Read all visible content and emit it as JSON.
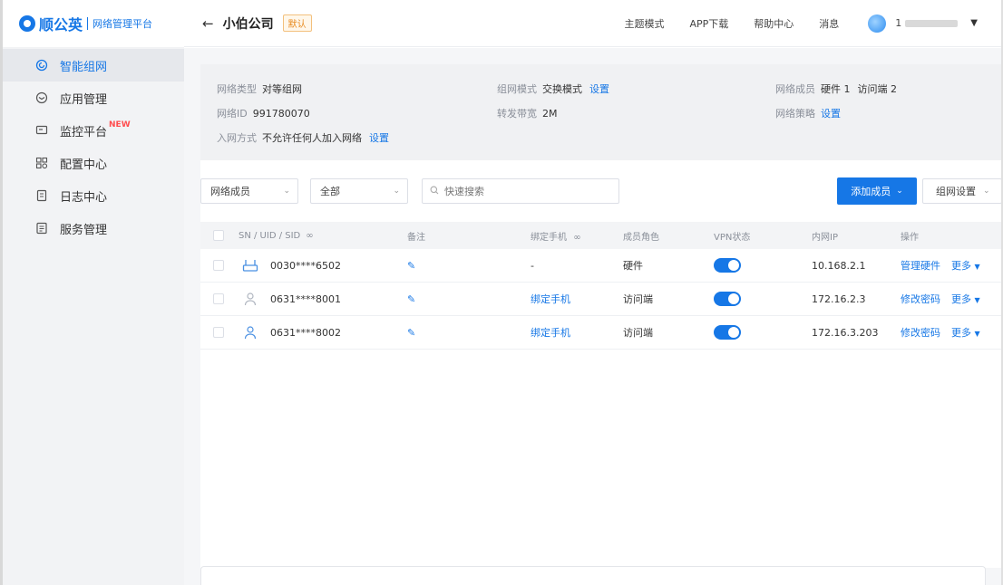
{
  "brand": {
    "name": "顺公英",
    "subtitle": "网络管理平台",
    "accent": "#1677e6"
  },
  "sidebar": {
    "items": [
      {
        "label": "智能组网",
        "icon": "network-icon",
        "active": true
      },
      {
        "label": "应用管理",
        "icon": "app-icon",
        "active": false
      },
      {
        "label": "监控平台",
        "icon": "monitor-icon",
        "active": false,
        "badge": "NEW"
      },
      {
        "label": "配置中心",
        "icon": "config-icon",
        "active": false
      },
      {
        "label": "日志中心",
        "icon": "log-icon",
        "active": false
      },
      {
        "label": "服务管理",
        "icon": "service-icon",
        "active": false
      }
    ]
  },
  "header": {
    "company": "小伯公司",
    "tag": "默认",
    "nav": [
      "主题模式",
      "APP下载",
      "帮助中心",
      "消息"
    ],
    "user_prefix": "1"
  },
  "info": {
    "network_type_label": "网络类型",
    "network_type": "对等组网",
    "network_mode_label": "组网模式",
    "network_mode": "交换模式",
    "network_mode_link": "设置",
    "network_members_label": "网络成员",
    "network_members": "硬件 1",
    "network_visitors": "访问端 2",
    "network_id_label": "网络ID",
    "network_id": "991780070",
    "bandwidth_label": "转发带宽",
    "bandwidth": "2M",
    "network_policy_label": "网络策略",
    "network_policy_link": "设置",
    "join_label": "入网方式",
    "join_value": "不允许任何人加入网络",
    "join_link": "设置"
  },
  "toolbar": {
    "filter1": "网络成员",
    "filter2": "全部",
    "search_placeholder": "快速搜索",
    "add_button": "添加成员",
    "settings_button": "组网设置"
  },
  "table": {
    "columns": [
      "SN / UID / SID",
      "备注",
      "绑定手机",
      "成员角色",
      "VPN状态",
      "内网IP",
      "操作"
    ],
    "rows": [
      {
        "device": "router-icon",
        "sn": "0030****6502",
        "phone": "-",
        "phone_link": false,
        "role": "硬件",
        "vpn": true,
        "ip": "10.168.2.1",
        "op": "管理硬件",
        "more": "更多"
      },
      {
        "device": "user-icon",
        "sn": "0631****8001",
        "phone": "绑定手机",
        "phone_link": true,
        "role": "访问端",
        "vpn": true,
        "ip": "172.16.2.3",
        "op": "修改密码",
        "more": "更多"
      },
      {
        "device": "user-icon",
        "sn": "0631****8002",
        "phone": "绑定手机",
        "phone_link": true,
        "role": "访问端",
        "vpn": true,
        "ip": "172.16.3.203",
        "op": "修改密码",
        "more": "更多"
      }
    ]
  }
}
